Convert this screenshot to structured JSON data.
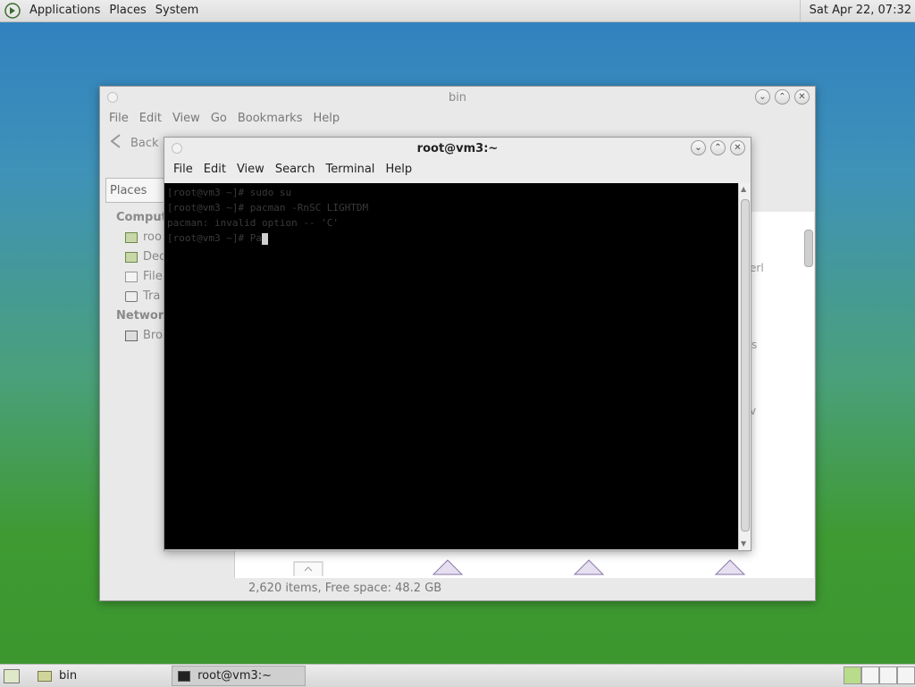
{
  "top_panel": {
    "menus": [
      "Applications",
      "Places",
      "System"
    ],
    "clock": "Sat Apr 22, 07:32"
  },
  "file_manager": {
    "title": "bin",
    "menus": [
      "File",
      "Edit",
      "View",
      "Go",
      "Bookmarks",
      "Help"
    ],
    "back_label": "Back",
    "places_label": "Places",
    "sidebar": {
      "computer_header": "Comput",
      "computer_items": [
        "roo",
        "Dec",
        "File",
        "Tra"
      ],
      "network_header": "Network",
      "network_items": [
        "Bro"
      ]
    },
    "status": "2,620 items, Free space: 48.2 GB",
    "fragments": [
      "erl",
      "s",
      "v"
    ]
  },
  "terminal": {
    "title": "root@vm3:~",
    "menus": [
      "File",
      "Edit",
      "View",
      "Search",
      "Terminal",
      "Help"
    ],
    "lines": [
      "[root@vm3 ~]# sudo su",
      "[root@vm3 ~]# pacman -RnSC LIGHTDM",
      "pacman: invalid option -- 'C'",
      "[root@vm3 ~]# Pa"
    ]
  },
  "taskbar": {
    "tasks": [
      "bin",
      "root@vm3:~"
    ]
  }
}
